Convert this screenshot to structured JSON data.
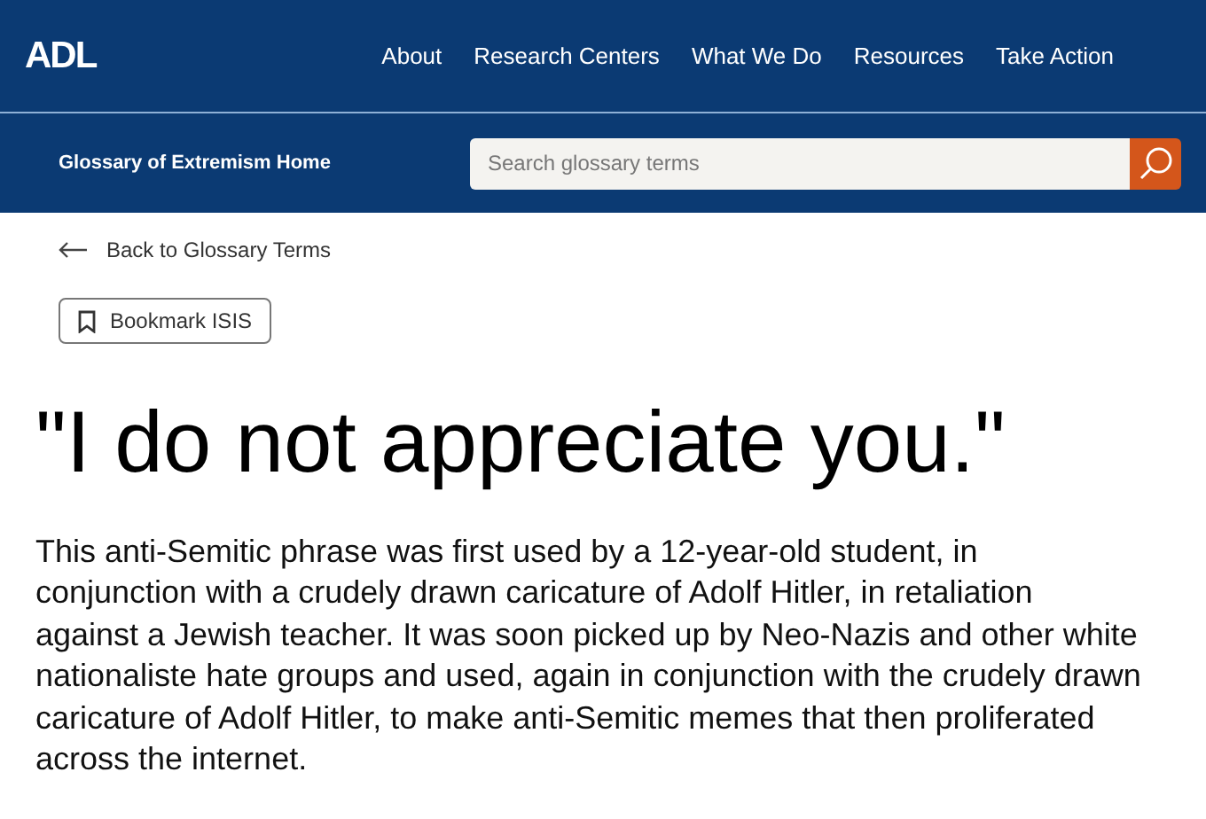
{
  "logo": "ADL",
  "nav": [
    "About",
    "Research Centers",
    "What We Do",
    "Resources",
    "Take Action"
  ],
  "subnav": {
    "title": "Glossary of Extremism Home",
    "search": {
      "placeholder": "Search glossary terms"
    }
  },
  "back_link": "Back to Glossary Terms",
  "bookmark_button": "Bookmark ISIS",
  "heading": "\"I do not appreciate you.\"",
  "description": "This anti-Semitic phrase was first used by a 12-year-old student, in conjunction with a crudely drawn caricature of Adolf Hitler, in retaliation against a Jewish teacher. It was soon picked up by Neo-Nazis and other white nationaliste hate groups and used, again in conjunction with the crudely drawn caricature of Adolf Hitler, to make anti-Semitic memes that then proliferated across the internet."
}
